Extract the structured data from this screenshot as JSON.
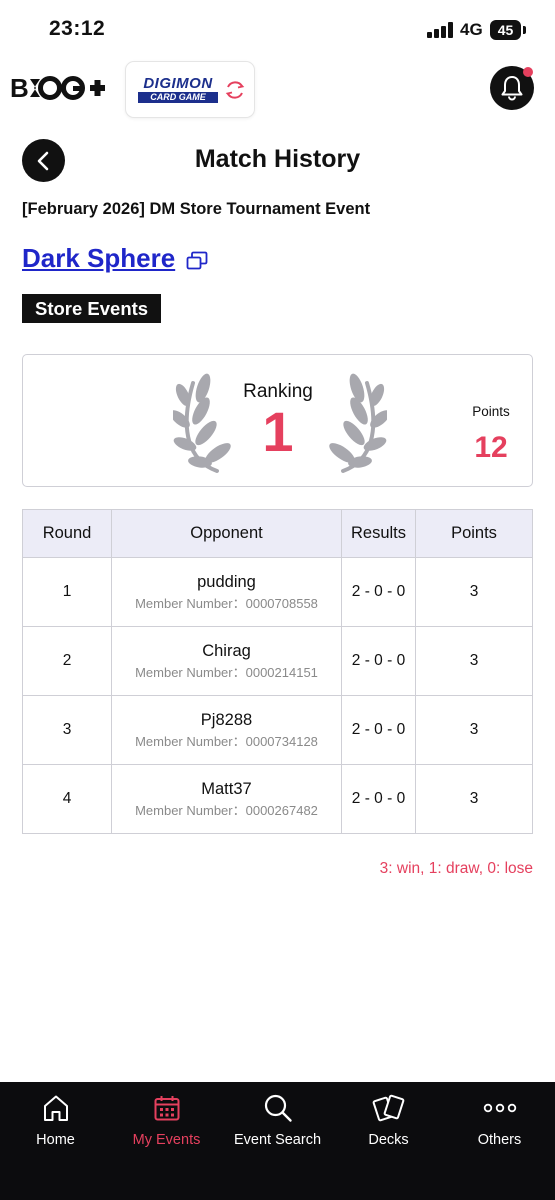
{
  "status_bar": {
    "time": "23:12",
    "network": "4G",
    "battery": "45"
  },
  "header": {
    "app_logo": "BCG+",
    "game_logo": {
      "title": "DIGIMON",
      "subtitle": "CARD GAME"
    },
    "notification_icon": "bell-icon"
  },
  "page": {
    "title": "Match History",
    "event_name": "[February 2026] DM Store Tournament Event",
    "store_name": "Dark Sphere",
    "category": "Store Events"
  },
  "summary": {
    "ranking_label": "Ranking",
    "ranking": "1",
    "points_label": "Points",
    "points": "12"
  },
  "table": {
    "headers": {
      "round": "Round",
      "opponent": "Opponent",
      "results": "Results",
      "points": "Points"
    },
    "rows": [
      {
        "round": "1",
        "opponent": "pudding",
        "member": "Member Number：0000708558",
        "results": "2 - 0 - 0",
        "points": "3"
      },
      {
        "round": "2",
        "opponent": "Chirag",
        "member": "Member Number：0000214151",
        "results": "2 - 0 - 0",
        "points": "3"
      },
      {
        "round": "3",
        "opponent": "Pj8288",
        "member": "Member Number：0000734128",
        "results": "2 - 0 - 0",
        "points": "3"
      },
      {
        "round": "4",
        "opponent": "Matt37",
        "member": "Member Number：0000267482",
        "results": "2 - 0 - 0",
        "points": "3"
      }
    ]
  },
  "legend": "3: win, 1: draw, 0: lose",
  "nav": {
    "items": [
      {
        "label": "Home",
        "icon": "home-icon",
        "active": false
      },
      {
        "label": "My Events",
        "icon": "calendar-icon",
        "active": true
      },
      {
        "label": "Event Search",
        "icon": "search-icon",
        "active": false
      },
      {
        "label": "Decks",
        "icon": "cards-icon",
        "active": false
      },
      {
        "label": "Others",
        "icon": "more-icon",
        "active": false
      }
    ]
  },
  "colors": {
    "accent": "#e5405e",
    "link": "#1f26c9",
    "dark": "#111111",
    "table_header": "#ececf7"
  }
}
